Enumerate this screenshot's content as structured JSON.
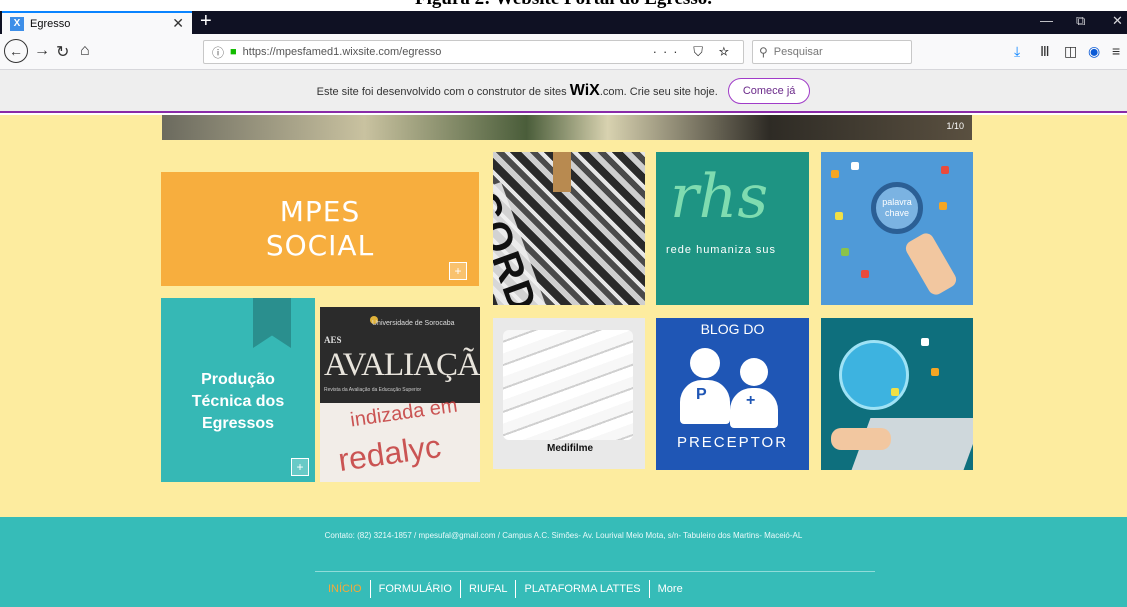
{
  "caption": "Figura 2: Website Portal do Egresso.",
  "browser": {
    "tab_title": "Egresso",
    "tab_favicon": "X",
    "new_tab": "+",
    "window_controls": [
      "—",
      "⧉",
      "✕"
    ],
    "url": "https://mpesfamed1.wixsite.com/egresso",
    "url_actions": "··· ⛉ ☆",
    "search_placeholder": "Pesquisar"
  },
  "wix_banner": {
    "text_before": "Este site foi desenvolvido com o construtor de sites ",
    "logo": "WiX",
    "text_after": ".com. Crie seu site hoje.",
    "button": "Comece já"
  },
  "slider": {
    "counter": "1/10"
  },
  "tiles": {
    "mpes_line1": "MPES",
    "mpes_line2": "SOCIAL",
    "prod_line1": "Produção",
    "prod_line2": "Técnica dos",
    "prod_line3": "Egressos",
    "plus": "+",
    "aval_uni": "Universidade de Sorocaba",
    "aval_aes": "AES",
    "aval_title": "AVALIAÇÃO",
    "aval_sub": "Revista da Avaliação da Educação Superior",
    "aval_stamp1": "indizada em",
    "aval_stamp2": "redalyc",
    "cordel": "CORDEL",
    "rhs_logo": "rhs",
    "rhs_sub": "rede humaniza sus",
    "palavra_1": "palavra",
    "palavra_2": "chave",
    "medi_label": "Medifilme",
    "blog_top": "BLOG DO",
    "blog_bottom": "PRECEPTOR",
    "blog_p": "P"
  },
  "footer": {
    "contact": "Contato: (82) 3214-1857  /  mpesufal@gmail.com  /  Campus A.C. Simões- Av. Lourival Melo Mota, s/n- Tabuleiro dos Martins- Maceió-AL",
    "nav": [
      "INÍCIO",
      "FORMULÁRIO",
      "RIUFAL",
      "PLATAFORMA LATTES",
      "More"
    ]
  },
  "colors": {
    "site_bg": "#fdec9f",
    "mpes_tile": "#f7ae3e",
    "prod_tile": "#36b8b5",
    "footer_bg": "#36bcb8",
    "nav_active": "#f2a93b",
    "wix_accent": "#a03cc8"
  }
}
